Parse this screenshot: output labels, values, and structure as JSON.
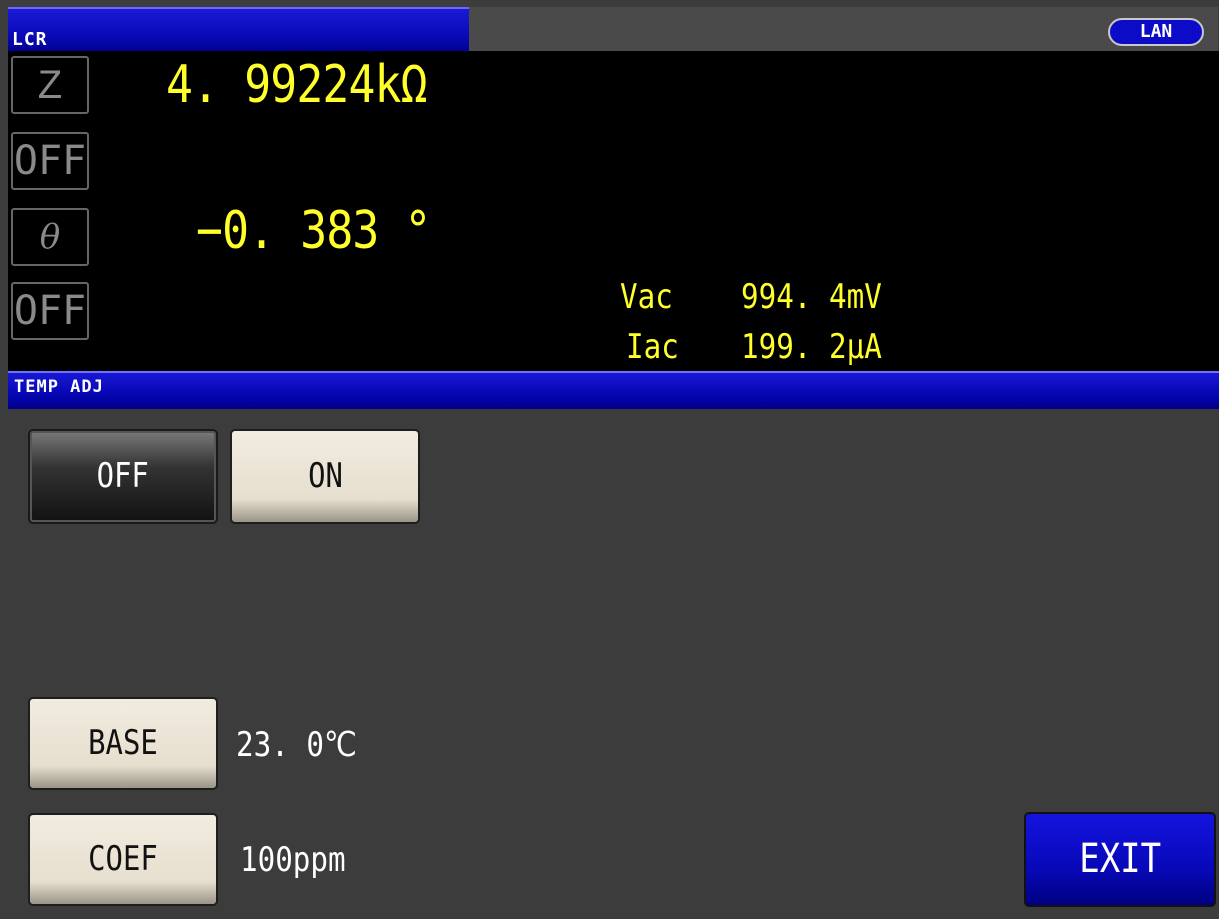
{
  "header": {
    "mode_title": "LCR",
    "lan_label": "LAN"
  },
  "measurement": {
    "param1_label": "Z",
    "param1_value": "4. 99224kΩ",
    "param2_label": "OFF",
    "param3_label": "θ",
    "param3_value": "−0. 383 °",
    "param4_label": "OFF",
    "monitor": {
      "vac_label": "Vac",
      "vac_value": "994. 4mV",
      "iac_label": "Iac",
      "iac_value": "199. 2μA"
    }
  },
  "section": {
    "title": "TEMP ADJ"
  },
  "temp_adj": {
    "off_label": "OFF",
    "on_label": "ON",
    "state": "OFF",
    "base_label": "BASE",
    "base_value": "23. 0℃",
    "coef_label": "COEF",
    "coef_value": "100ppm",
    "exit_label": "EXIT"
  },
  "colors": {
    "measurement_text": "#ffff2c",
    "header_blue": "#0a0ab8",
    "panel_bg": "#3c3c3c"
  }
}
